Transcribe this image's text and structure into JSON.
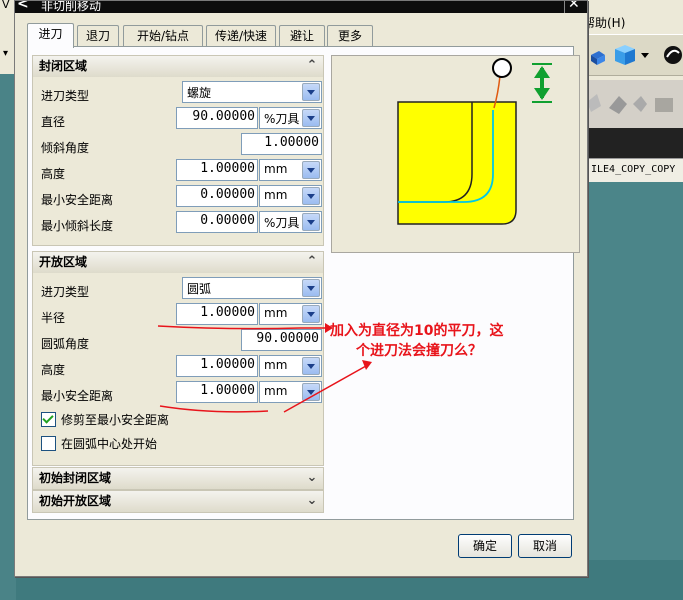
{
  "dialog": {
    "title": "非切削移动",
    "back_glyph": "<",
    "close_glyph": "✕"
  },
  "tabs": [
    {
      "label": "进刀",
      "active": true
    },
    {
      "label": "退刀"
    },
    {
      "label": "开始/钻点"
    },
    {
      "label": "传递/快速"
    },
    {
      "label": "避让"
    },
    {
      "label": "更多"
    }
  ],
  "closed_region": {
    "header": "封闭区域",
    "collapse_glyph": "⌃",
    "rows": [
      {
        "label": "进刀类型",
        "value": "螺旋"
      },
      {
        "label": "直径",
        "value": "90.00000",
        "unit": "%刀具"
      },
      {
        "label": "倾斜角度",
        "value": "1.00000"
      },
      {
        "label": "高度",
        "value": "1.00000",
        "unit": "mm"
      },
      {
        "label": "最小安全距离",
        "value": "0.00000",
        "unit": "mm"
      },
      {
        "label": "最小倾斜长度",
        "value": "0.00000",
        "unit": "%刀具"
      }
    ]
  },
  "open_region": {
    "header": "开放区域",
    "collapse_glyph": "⌃",
    "rows": [
      {
        "label": "进刀类型",
        "value": "圆弧"
      },
      {
        "label": "半径",
        "value": "1.00000",
        "unit": "mm"
      },
      {
        "label": "圆弧角度",
        "value": "90.00000"
      },
      {
        "label": "高度",
        "value": "1.00000",
        "unit": "mm"
      },
      {
        "label": "最小安全距离",
        "value": "1.00000",
        "unit": "mm"
      }
    ],
    "checkboxes": [
      {
        "label": "修剪至最小安全距离",
        "checked": true
      },
      {
        "label": "在圆弧中心处开始",
        "checked": false
      }
    ]
  },
  "initial_closed": {
    "header": "初始封闭区域",
    "expand_glyph": "⌄"
  },
  "initial_open": {
    "header": "初始开放区域",
    "expand_glyph": "⌄"
  },
  "buttons": {
    "ok": "确定",
    "cancel": "取消"
  },
  "background_app": {
    "menu_help": "帮助(H)",
    "tab_text": "ILE4_COPY_COPY",
    "left_menu_letter": "V"
  },
  "annotation": {
    "line1": "加入为直径为10的平刀，这",
    "line2": "个进刀法会撞刀么？",
    "color": "#e8141b"
  },
  "preview_colors": {
    "part": "#ffff00",
    "tool_path": "#00c8e8",
    "arrow": "#10a030",
    "lead": "#e05a10"
  }
}
